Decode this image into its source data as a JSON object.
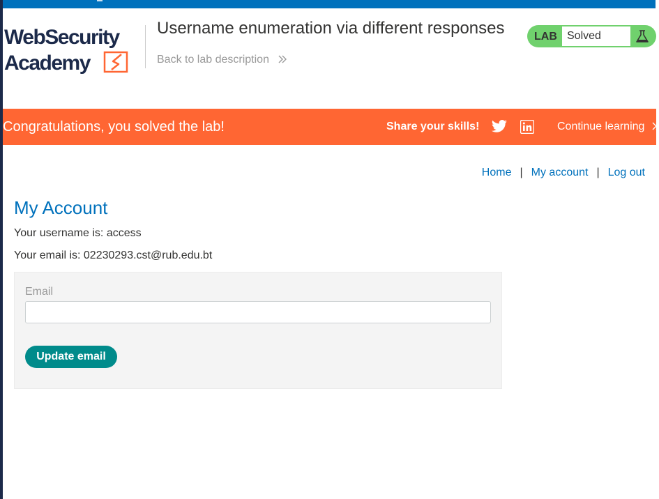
{
  "header": {
    "logo_alt": "Web Security Academy",
    "lab_title": "Username enumeration via different responses",
    "back_link": "Back to lab description",
    "lab_badge": "LAB",
    "lab_status": "Solved"
  },
  "banner": {
    "congrats": "Congratulations, you solved the lab!",
    "share": "Share your skills!",
    "icons": [
      "twitter-icon",
      "linkedin-icon"
    ],
    "continue": "Continue learning"
  },
  "nav": {
    "home": "Home",
    "my_account": "My account",
    "log_out": "Log out",
    "separator": "|"
  },
  "account": {
    "heading": "My Account",
    "username_line": "Your username is: access",
    "email_line": "Your email is: 02230293.cst@rub.edu.bt",
    "email_label": "Email",
    "email_value": "",
    "update_button": "Update email"
  },
  "colors": {
    "brand_blue": "#0071bc",
    "banner_orange": "#ff6633",
    "solved_green": "#70d16d",
    "button_teal": "#008b8b"
  }
}
